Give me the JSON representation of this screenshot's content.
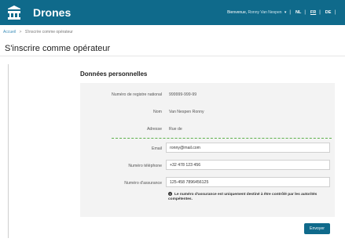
{
  "header": {
    "logo_icon": "building-icon",
    "brand": "Drones",
    "welcome_text": "Bienvenue,",
    "user_name": "Ronny Van Nespen",
    "languages": [
      "NL",
      "FR",
      "DE"
    ],
    "active_language": "FR",
    "separator": "|"
  },
  "breadcrumb": {
    "home": "Accueil",
    "arrow": ">",
    "current": "S'inscrire comme opérateur"
  },
  "page_title": "S'inscrire comme opérateur",
  "section_title": "Données personnelles",
  "personal": {
    "registry_label": "Numéro de registre national",
    "registry_value": "999999-999-99",
    "name_label": "Nom",
    "name_value": "Van Nespen Ronny",
    "address_label": "Adresse",
    "address_value": "Rue de"
  },
  "contact": {
    "email_label": "Email",
    "email_value": "ronny@mail.com",
    "phone_label": "Numéro téléphone",
    "phone_value": "+32 478 123 456",
    "insurance_label": "Numéro d'assurance",
    "insurance_value": "125-458 7896456125"
  },
  "note": {
    "icon": "info-icon",
    "text": "Le numéro d'assurance est uniquement destiné à être contrôlé par les autorités compétentes."
  },
  "submit_label": "Envoyer",
  "colors": {
    "header_bg": "#0f6a8b",
    "card_bg": "#f3f3f3",
    "divider": "#5bb04a",
    "link": "#3a8cb8"
  }
}
